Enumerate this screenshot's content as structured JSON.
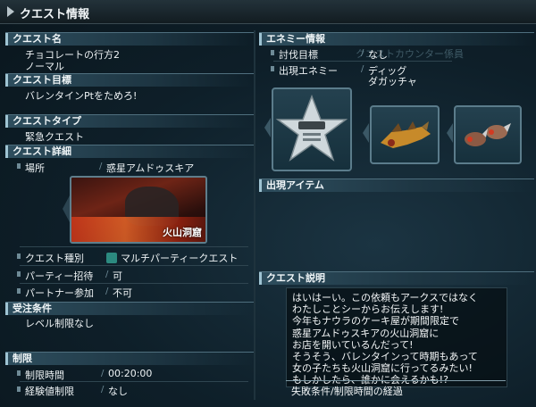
{
  "window": {
    "title": "クエスト情報"
  },
  "left": {
    "quest_name": {
      "header": "クエスト名",
      "line1": "チョコレートの行方2",
      "line2": "ノーマル"
    },
    "quest_goal": {
      "header": "クエスト目標",
      "text": "バレンタインPtをためろ!"
    },
    "quest_type": {
      "header": "クエストタイプ",
      "text": "緊急クエスト"
    },
    "quest_detail": {
      "header": "クエスト詳細",
      "location_label": "場所",
      "location_value": "惑星アムドゥスキア",
      "area_caption": "火山洞窟",
      "category_label": "クエスト種別",
      "category_value": "マルチパーティークエスト",
      "party_invite_label": "パーティー招待",
      "party_invite_value": "可",
      "partner_label": "パートナー参加",
      "partner_value": "不可"
    },
    "conditions": {
      "header": "受注条件",
      "text": "レベル制限なし"
    },
    "limits": {
      "header": "制限",
      "time_label": "制限時間",
      "time_value": "00:20:00",
      "exp_label": "経験値制限",
      "exp_value": "なし"
    }
  },
  "right": {
    "enemy": {
      "header": "エネミー情報",
      "target_label": "討伐目標",
      "target_value": "なし",
      "spawn_label": "出現エネミー",
      "spawn_1": "ディッグ",
      "spawn_2": "ダガッチャ",
      "ghost_text": "クエストカウンター係員"
    },
    "items": {
      "header": "出現アイテム"
    },
    "description": {
      "header": "クエスト説明",
      "body": "はいはーい。この依頼もアークスではなく\nわたしことシーからお伝えします!\n今年もナウラのケーキ屋が期間限定で\n惑星アムドゥスキアの火山洞窟に\nお店を開いているんだって!\nそうそう、バレンタインって時期もあって\n女の子たちも火山洞窟に行ってるみたい!\nもしかしたら、誰かに会えるかも!?",
      "fail_condition": "失敗条件/制限時間の経過"
    }
  },
  "colors": {
    "header_bar": "#2e4e5e",
    "accent": "#9fc4d3",
    "lava": "#f06a2a"
  }
}
